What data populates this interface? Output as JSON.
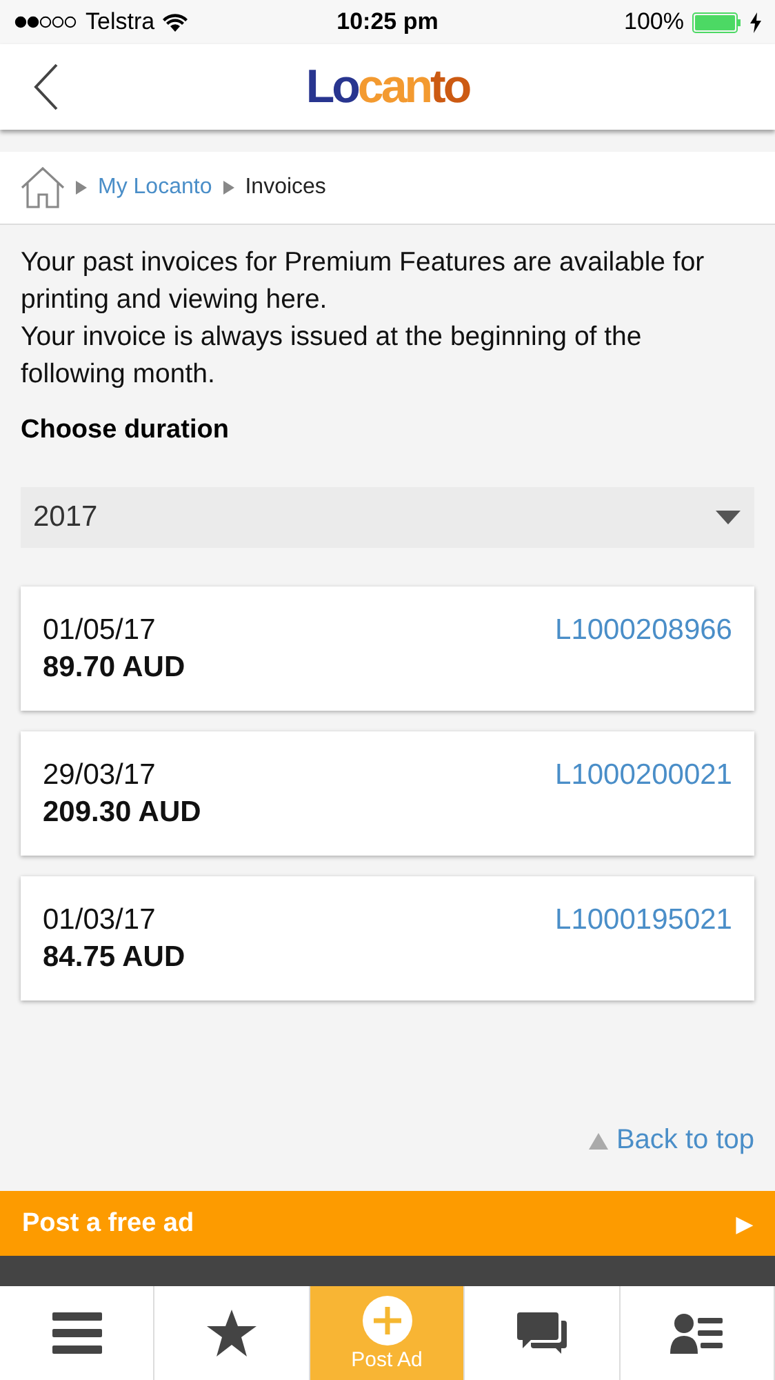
{
  "status_bar": {
    "carrier": "Telstra",
    "time": "10:25 pm",
    "battery": "100%"
  },
  "header": {
    "logo": [
      {
        "text": "Lo",
        "color": "#28358f"
      },
      {
        "text": "can",
        "color": "#f39a30"
      },
      {
        "text": "to",
        "color": "#cc5a12"
      }
    ]
  },
  "breadcrumb": [
    {
      "label": "My Locanto",
      "kind": "link"
    },
    {
      "label": "Invoices",
      "kind": "current"
    }
  ],
  "intro": [
    "Your past invoices for Premium Features are available for printing and viewing here.",
    "Your invoice is always issued at the beginning of the following month."
  ],
  "duration": {
    "label": "Choose duration",
    "value": "2017"
  },
  "invoices": [
    {
      "date": "01/05/17",
      "amount": "89.70 AUD",
      "number": "L1000208966"
    },
    {
      "date": "29/03/17",
      "amount": "209.30 AUD",
      "number": "L1000200021"
    },
    {
      "date": "01/03/17",
      "amount": "84.75 AUD",
      "number": "L1000195021"
    }
  ],
  "back_to_top": "Back to top",
  "post_banner": {
    "label": "Post a free ad",
    "arrow": "▶"
  },
  "tab_bar": [
    {
      "kind": "menu",
      "selected": false
    },
    {
      "kind": "star",
      "selected": false
    },
    {
      "kind": "post",
      "label": "Post Ad",
      "selected": true
    },
    {
      "kind": "chat",
      "selected": false
    },
    {
      "kind": "account",
      "selected": false
    }
  ]
}
